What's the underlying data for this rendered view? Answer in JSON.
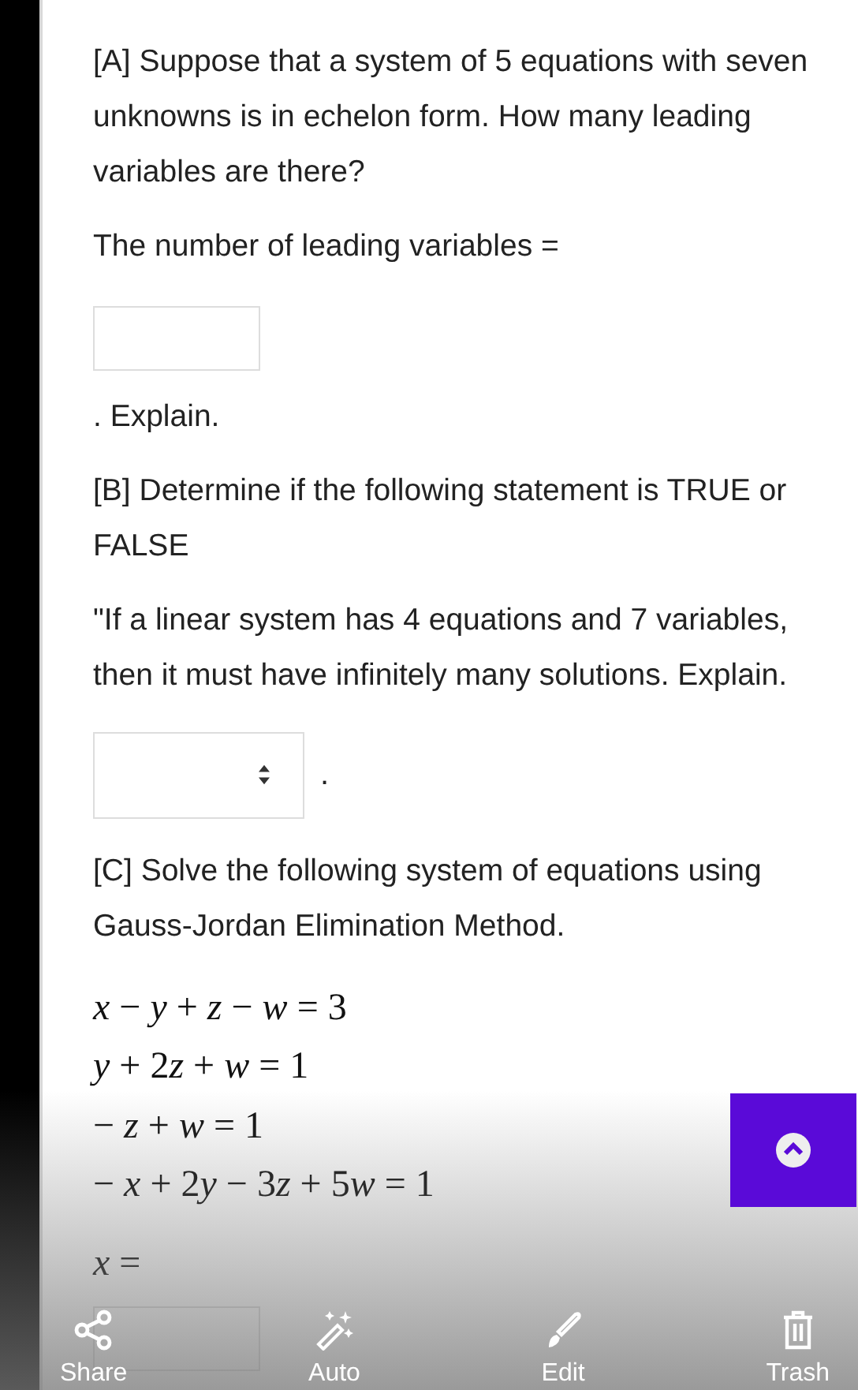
{
  "blocks": [
    {
      "kind": "paragraph",
      "text": "[A] Suppose that a system of 5 equations with seven unknowns is in echelon form. How many leading variables are there?"
    },
    {
      "kind": "paragraph",
      "text": "The number of leading variables ="
    },
    {
      "kind": "answer_box"
    },
    {
      "kind": "paragraph",
      "text": ". Explain."
    },
    {
      "kind": "paragraph",
      "text": "[B] Determine  if the following statement is TRUE or FALSE"
    },
    {
      "kind": "paragraph",
      "text": "\"If a linear system has 4 equations and 7 variables, then  it must have infinitely many solutions. Explain."
    },
    {
      "kind": "dropdown",
      "suffix": "."
    },
    {
      "kind": "paragraph",
      "text": "[C] Solve the following system of equations using Gauss-Jordan Elimination Method."
    },
    {
      "kind": "equations",
      "lines": [
        "x − y + z − w = 3",
        "y + 2z + w = 1",
        "− z + w = 1",
        "− x + 2y − 3z + 5w = 1"
      ]
    },
    {
      "kind": "math_label",
      "text": "x ="
    },
    {
      "kind": "answer_box"
    }
  ],
  "toolbar": [
    {
      "kind": "share",
      "label": "Share"
    },
    {
      "kind": "auto",
      "label": "Auto"
    },
    {
      "kind": "edit",
      "label": "Edit"
    },
    {
      "kind": "trash",
      "label": "Trash"
    }
  ]
}
